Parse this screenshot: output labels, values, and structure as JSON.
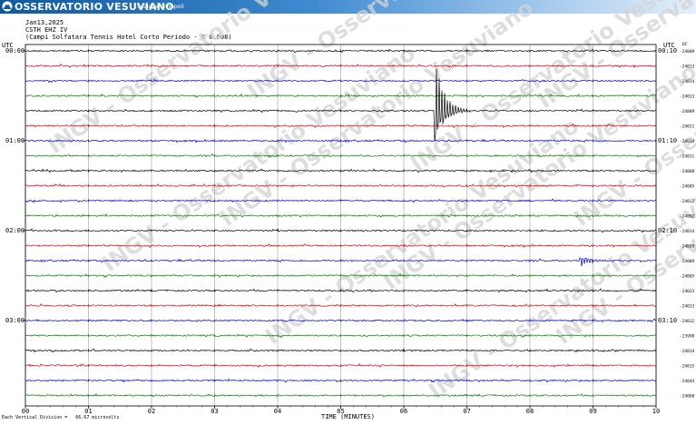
{
  "header": {
    "brand": "OSSERVATORIO VESUVIANO",
    "section": "Sezione di Napoli",
    "colors": {
      "bar_start": "#0f5a9c",
      "bar_end": "#e4f0fb"
    }
  },
  "station": {
    "date": "Jan13,2025",
    "channel": "CSTH EHZ IV",
    "description": "(Campi Solfatara Tennis Hotel Corto Periodo - G 0.008)"
  },
  "watermark": "INGV - Osservatorio Vesuviano",
  "footer_note": "Each Vertical Division =   66.67 microvolts",
  "chart_data": {
    "type": "line",
    "title": "",
    "xlabel": "TIME (MINUTES)",
    "x_ticks": [
      "00",
      "01",
      "02",
      "03",
      "04",
      "05",
      "06",
      "07",
      "08",
      "09",
      "10"
    ],
    "xlim": [
      0,
      10
    ],
    "left_label": "UTC",
    "right_label": "UTC",
    "corner_label": "DC",
    "left_time_labels": [
      {
        "trace": 0,
        "text": "00:00"
      },
      {
        "trace": 6,
        "text": "01:00"
      },
      {
        "trace": 12,
        "text": "02:00"
      },
      {
        "trace": 18,
        "text": "03:00"
      }
    ],
    "right_time_labels": [
      {
        "trace": 0,
        "text": "00:10"
      },
      {
        "trace": 6,
        "text": "01:10"
      },
      {
        "trace": 12,
        "text": "02:10"
      },
      {
        "trace": 18,
        "text": "03:10"
      }
    ],
    "trace_colors": [
      "#000000",
      "#d10000",
      "#0000d0",
      "#007a00"
    ],
    "dc_offsets": [
      "-24009",
      "-24013",
      "-24014",
      "-24013",
      "-24009",
      "-24021",
      "-24014",
      "-24011",
      "-24008",
      "-24005",
      "-24012",
      "-24062",
      "-24014",
      "-24009",
      "-24009",
      "-24005",
      "-24033",
      "-24013",
      "-24012",
      "-23998",
      "-24014",
      "-24015",
      "-24044",
      "-24068"
    ],
    "events": [
      {
        "trace": 4,
        "minute": 6.5,
        "amplitude_divisions": 8,
        "color": "#007a00"
      },
      {
        "trace": 14,
        "minute": 8.8,
        "amplitude_divisions": 1,
        "color": "#007a00"
      }
    ],
    "grid": true
  }
}
